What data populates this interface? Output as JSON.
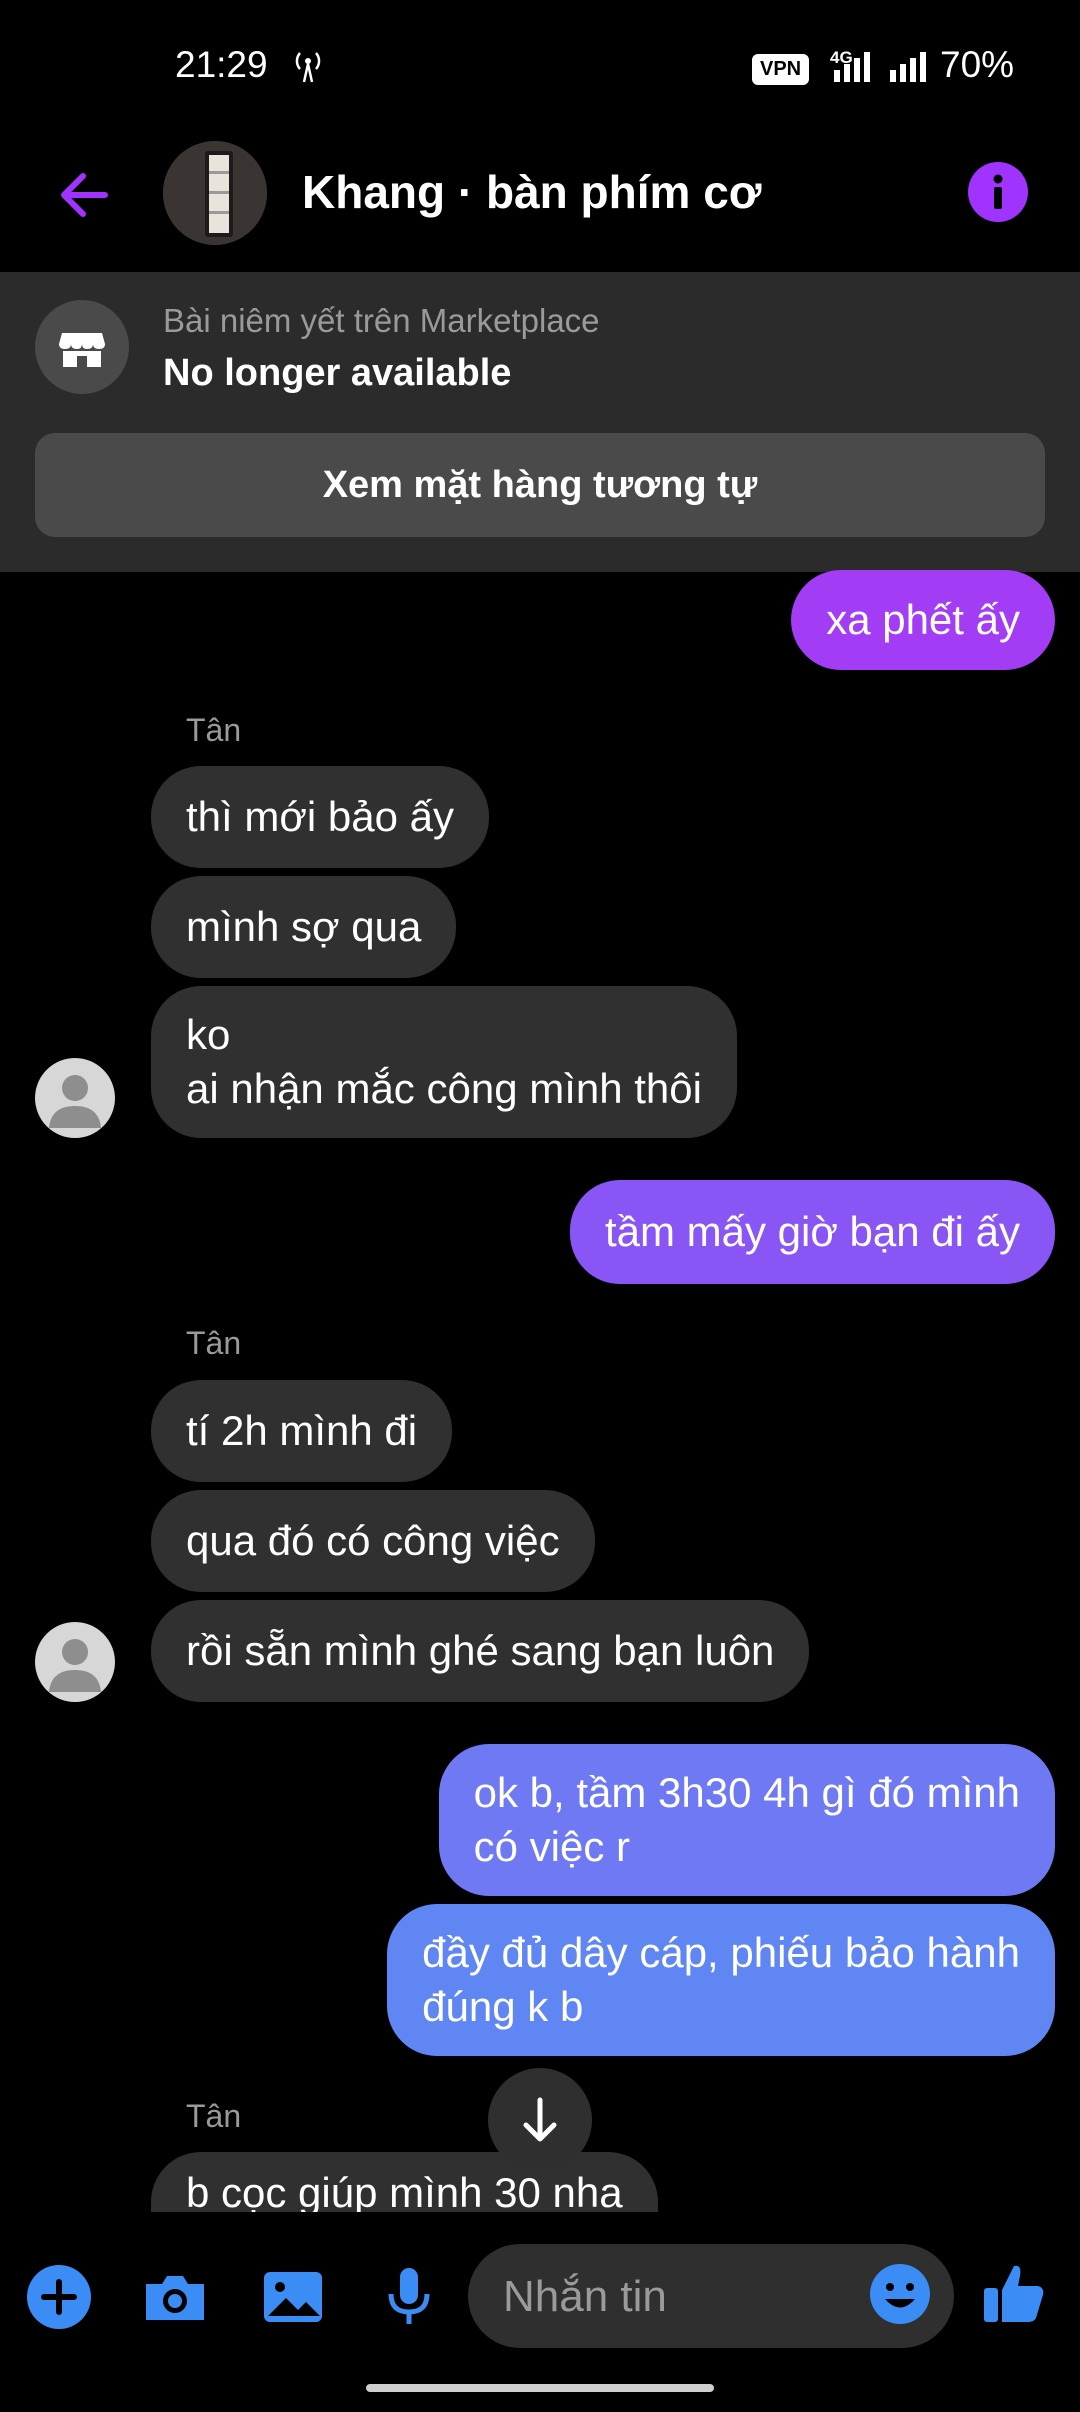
{
  "status_bar": {
    "time": "21:29",
    "vpn_label": "VPN",
    "network_label": "4G",
    "battery": "70%"
  },
  "header": {
    "title": "Khang · bàn phím cơ"
  },
  "marketplace": {
    "label": "Bài niêm yết trên Marketplace",
    "status": "No longer available",
    "button_label": "Xem mặt hàng tương tự"
  },
  "messages": [
    {
      "dir": "out",
      "lines": [
        "xa phết ấy"
      ]
    },
    {
      "sender": "Tân"
    },
    {
      "dir": "in",
      "lines": [
        "thì mới bảo ấy"
      ]
    },
    {
      "dir": "in",
      "lines": [
        "mình sợ qua"
      ]
    },
    {
      "dir": "in",
      "lines": [
        "ko",
        "ai nhận mắc công mình thôi"
      ]
    },
    {
      "dir": "out",
      "lines": [
        "tầm mấy giờ bạn đi ấy"
      ]
    },
    {
      "sender": "Tân"
    },
    {
      "dir": "in",
      "lines": [
        "tí 2h mình đi"
      ]
    },
    {
      "dir": "in",
      "lines": [
        "qua đó có công việc"
      ]
    },
    {
      "dir": "in",
      "lines": [
        "rồi sẵn mình ghé sang bạn luôn"
      ]
    },
    {
      "dir": "out",
      "lines": [
        "ok b, tầm 3h30 4h gì đó mình",
        "có việc r"
      ]
    },
    {
      "dir": "out",
      "lines": [
        "đầy đủ dây cáp, phiếu bảo hành",
        "đúng k b"
      ]
    },
    {
      "sender": "Tân"
    },
    {
      "dir": "in",
      "lines": [
        "b cọc giúp mình 30 nha"
      ]
    }
  ],
  "composer": {
    "placeholder": "Nhắn tin"
  },
  "colors": {
    "accent": "#a033ff",
    "out_bubble_1": "#a23cf5",
    "out_bubble_2": "#8a55f5",
    "out_bubble_3": "#6e79f3",
    "out_bubble_4": "#5f86f3",
    "in_bubble": "#303030",
    "icon_blue": "#3b8cf5"
  }
}
